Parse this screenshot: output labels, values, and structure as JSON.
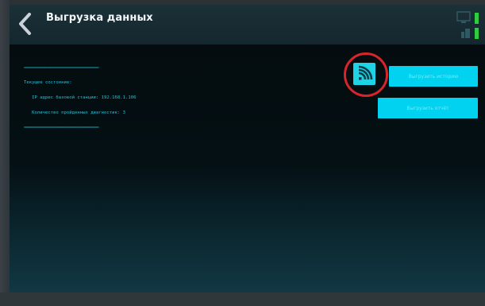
{
  "header": {
    "title": "Выгрузка данных",
    "back_icon": "chevron-left-icon",
    "status_icons": [
      "monitor-icon",
      "network-icon"
    ]
  },
  "console": {
    "separator": "==================================",
    "lines": [
      "Текущее состояние:",
      "   IP адрес базовой станции: 192.168.1.106",
      "   Количество пройденных диагностик: 3"
    ]
  },
  "actions": {
    "wifi_icon": "wifi-icon",
    "upload_history_label": "Выгрузить историю",
    "upload_report_label": "Выгрузить отчёт"
  },
  "colors": {
    "accent": "#00d2ef",
    "console_text": "#1fc0d4",
    "highlight_circle": "#d8242a",
    "status_green": "#2ecc40"
  }
}
